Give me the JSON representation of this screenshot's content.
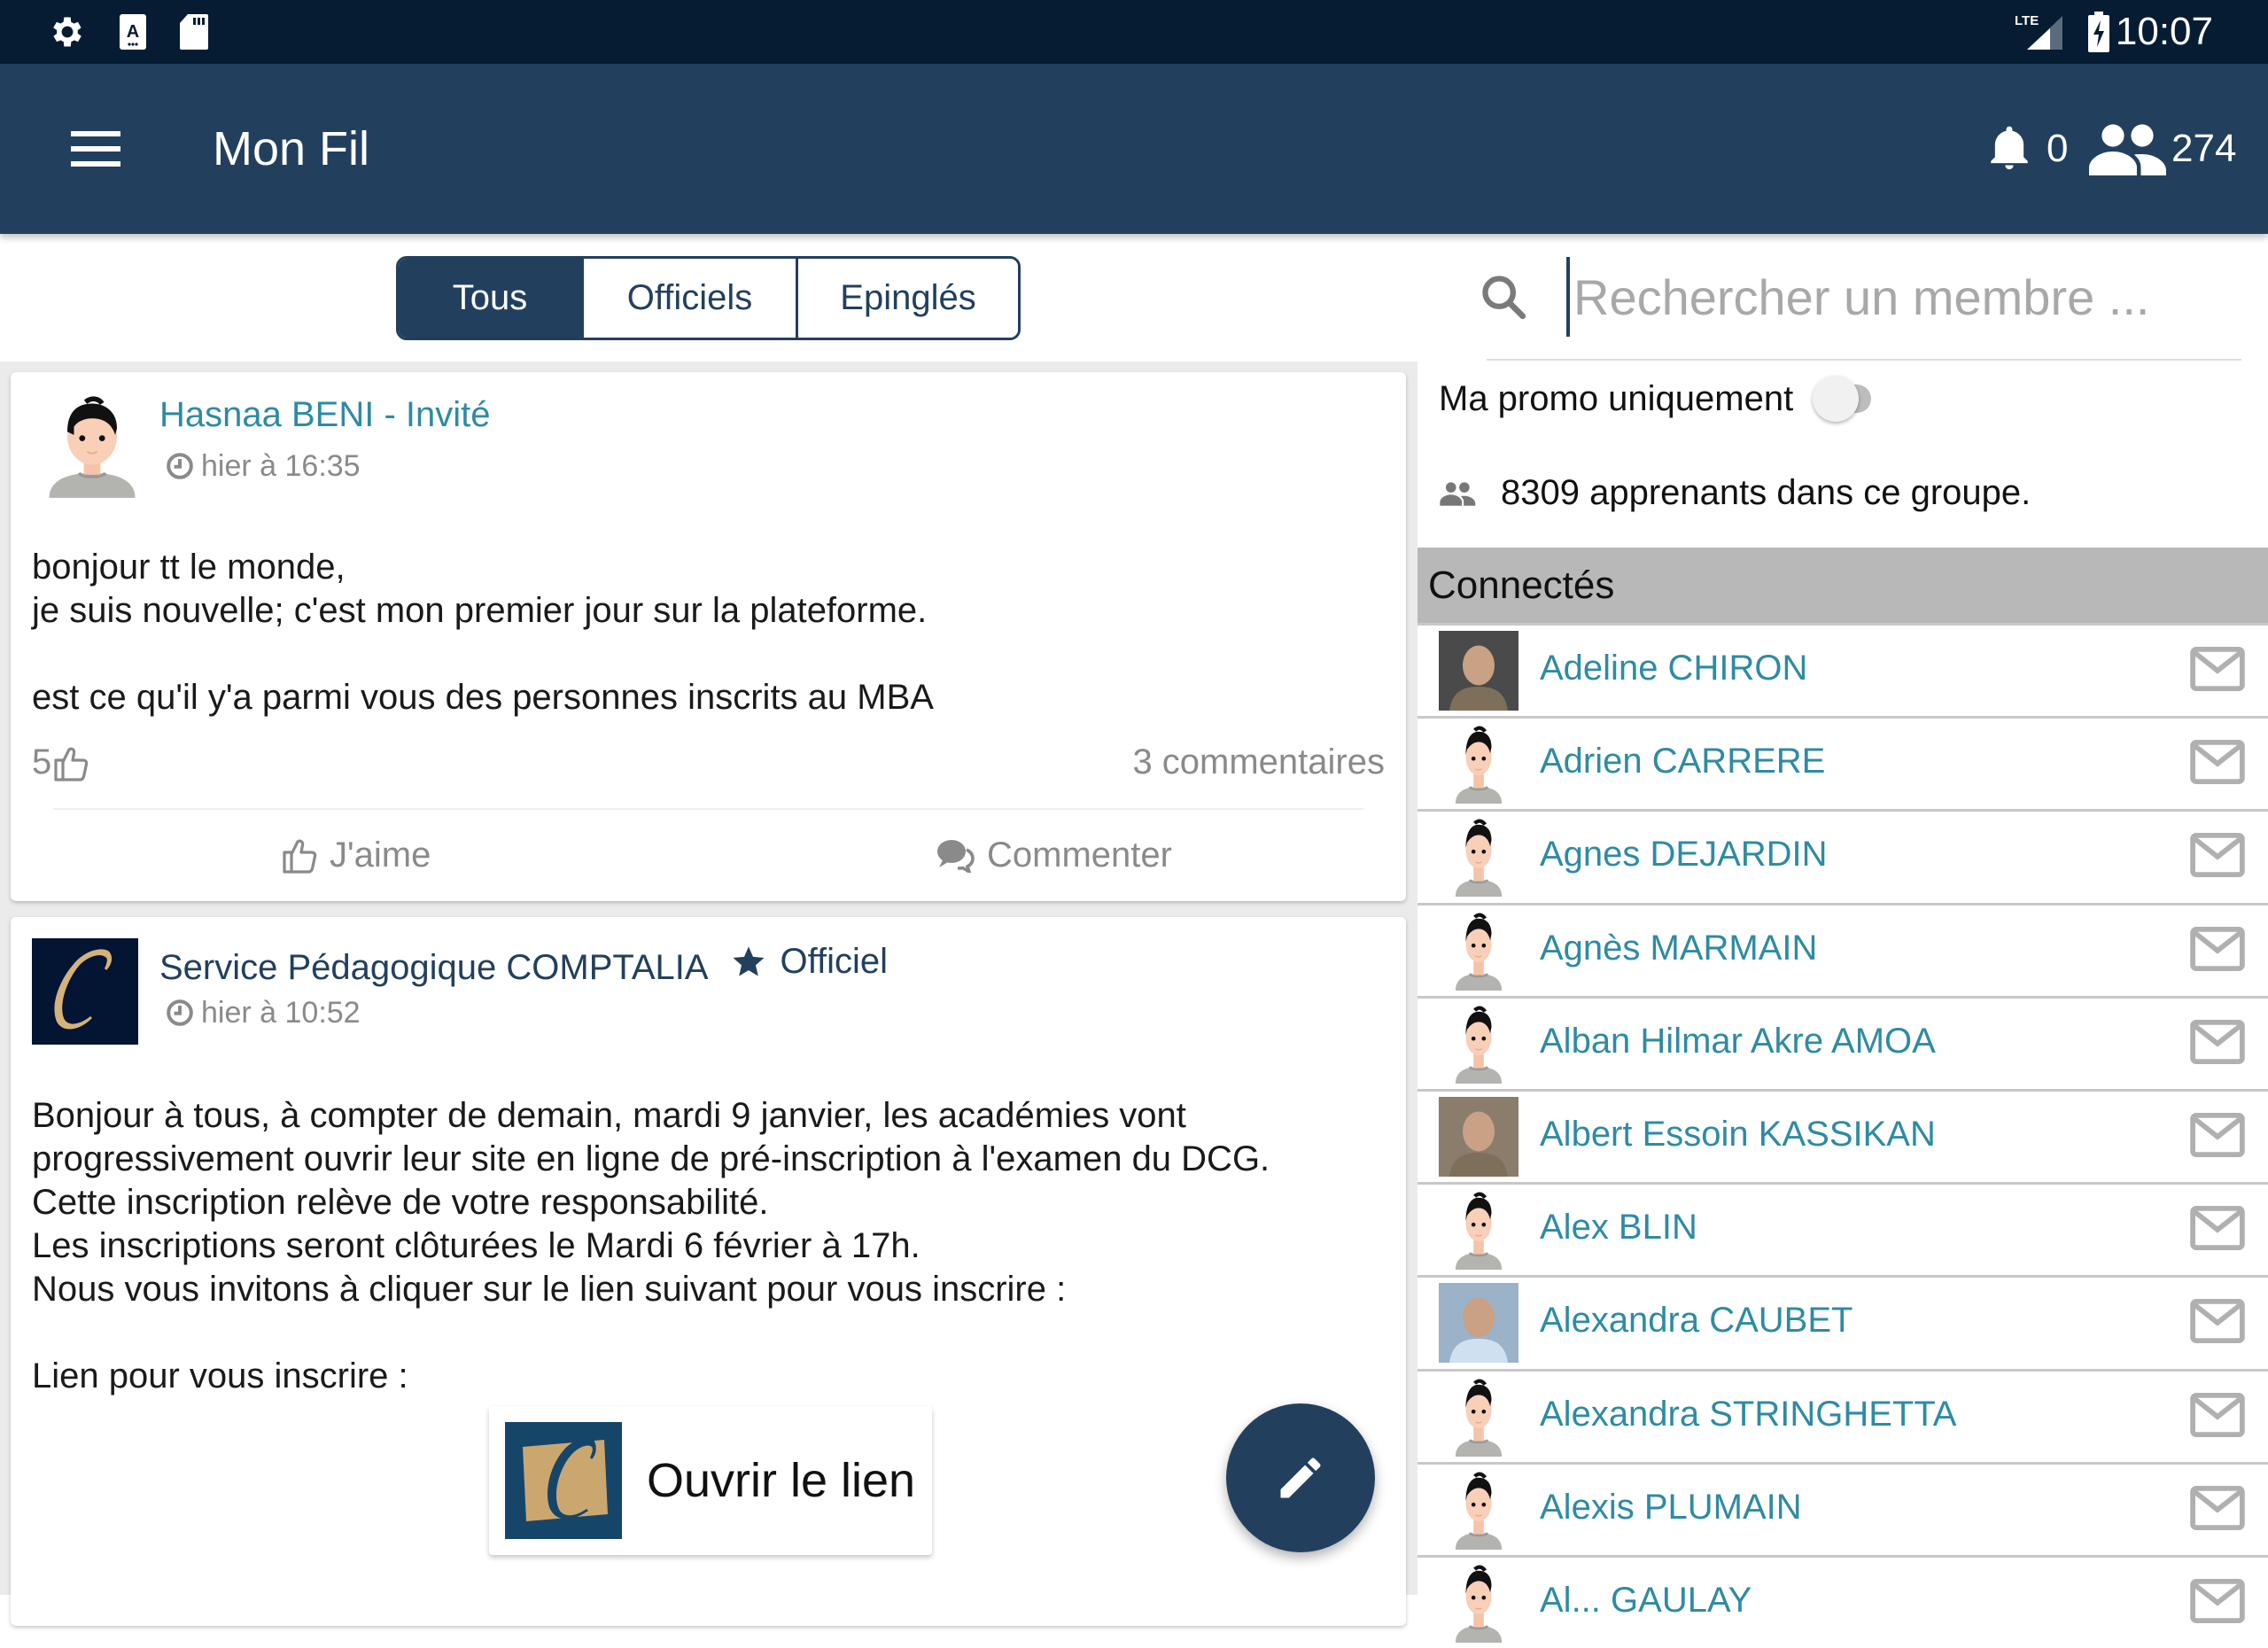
{
  "status_bar": {
    "left_icons": [
      "settings-icon",
      "font-a-icon",
      "sd-card-icon"
    ],
    "network": "LTE",
    "time": "10:07"
  },
  "app_bar": {
    "title": "Mon Fil",
    "notifications_count": "0",
    "members_count": "274"
  },
  "feed": {
    "tabs": [
      {
        "label": "Tous",
        "active": true
      },
      {
        "label": "Officiels",
        "active": false
      },
      {
        "label": "Epinglés",
        "active": false
      }
    ],
    "posts": [
      {
        "author": "Hasnaa BENI - Invité",
        "time": "hier à 16:35",
        "body": "bonjour tt le monde,\nje suis nouvelle; c'est mon premier jour sur la plateforme.\n\nest ce qu'il y'a parmi vous des personnes inscrits au MBA",
        "likes": "5",
        "comments": "3 commentaires",
        "like_label": "J'aime",
        "comment_label": "Commenter"
      },
      {
        "author": "Service Pédagogique COMPTALIA",
        "badge": "Officiel",
        "time": "hier à 10:52",
        "body": "Bonjour à tous, à compter de demain, mardi 9 janvier, les académies vont\nprogressivement ouvrir leur site en ligne de pré-inscription à l'examen du DCG.\nCette inscription relève de votre responsabilité.\nLes inscriptions seront clôturées le Mardi 6 février à 17h.\nNous vous invitons à cliquer sur le lien suivant pour vous inscrire :\n\nLien pour vous inscrire :",
        "link_label": "Ouvrir le lien"
      }
    ]
  },
  "members_panel": {
    "search_placeholder": "Rechercher un membre ...",
    "search_value": "",
    "toggle_label": "Ma promo uniquement",
    "toggle_on": false,
    "group_count_text": "8309 apprenants dans ce groupe.",
    "connected_header": "Connectés",
    "members": [
      {
        "name": "Adeline CHIRON",
        "avatar": "photo"
      },
      {
        "name": "Adrien CARRERE",
        "avatar": "default"
      },
      {
        "name": "Agnes DEJARDIN",
        "avatar": "default"
      },
      {
        "name": "Agnès MARMAIN",
        "avatar": "default"
      },
      {
        "name": "Alban Hilmar Akre AMOA",
        "avatar": "default"
      },
      {
        "name": "Albert Essoin KASSIKAN",
        "avatar": "photo"
      },
      {
        "name": "Alex BLIN",
        "avatar": "default"
      },
      {
        "name": "Alexandra CAUBET",
        "avatar": "photo"
      },
      {
        "name": "Alexandra STRINGHETTA",
        "avatar": "default"
      },
      {
        "name": "Alexis PLUMAIN",
        "avatar": "default"
      },
      {
        "name": "Al... GAULAY",
        "avatar": "default"
      }
    ]
  },
  "colors": {
    "status_bar": "#061c33",
    "primary": "#22405e",
    "link_teal": "#2e8ba3",
    "muted_gray": "#8a8a8a",
    "header_gray": "#b8b8b8"
  }
}
